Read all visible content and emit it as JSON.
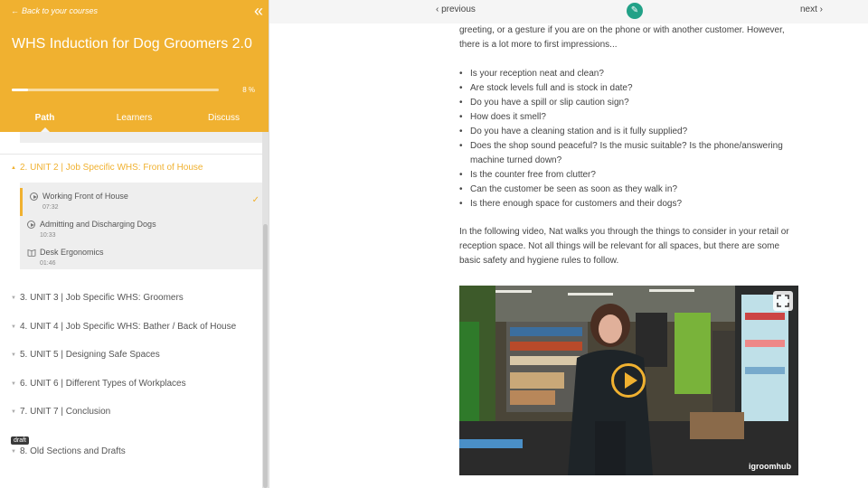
{
  "sidebar": {
    "back_link": "Back to your courses",
    "course_title": "WHS Induction for Dog Groomers 2.0",
    "progress_percent": 8,
    "progress_label": "8 %",
    "tabs": [
      "Path",
      "Learners",
      "Discuss"
    ],
    "units": [
      {
        "label": "2. UNIT 2 | Job Specific WHS: Front of House",
        "expanded": true
      },
      {
        "label": "3. UNIT 3 | Job Specific WHS: Groomers"
      },
      {
        "label": "4. UNIT 4 | Job Specific WHS: Bather / Back of House"
      },
      {
        "label": "5. UNIT 5 | Designing Safe Spaces"
      },
      {
        "label": "6. UNIT 6 | Different Types of Workplaces"
      },
      {
        "label": "7. UNIT 7 | Conclusion"
      },
      {
        "label": "8. Old Sections and Drafts",
        "badge": "draft"
      }
    ],
    "lessons": [
      {
        "title": "Working Front of House",
        "duration": "07:32",
        "icon": "play-circle-icon",
        "active": true,
        "completed": true
      },
      {
        "title": "Admitting and Discharging Dogs",
        "duration": "10:33",
        "icon": "play-circle-icon"
      },
      {
        "title": "Desk Ergonomics",
        "duration": "01:46",
        "icon": "book-icon"
      }
    ]
  },
  "topbar": {
    "previous_label": "‹ previous",
    "next_label": "next ›",
    "edit_icon": "pencil-icon"
  },
  "content": {
    "intro": "greeting, or a gesture if you are on the phone or with another customer. However, there is a lot more to first impressions...",
    "checklist": [
      "Is your reception neat and clean?",
      "Are stock levels full and is stock in date?",
      "Do you have a spill or slip caution sign?",
      "How does it smell?",
      "Do you have a cleaning station and is it fully supplied?",
      "Does the shop sound peaceful? Is the music suitable? Is the phone/answering machine turned down?",
      "Is the counter free from clutter?",
      "Can the customer be seen as soon as they walk in?",
      "Is there enough space for customers and their dogs?"
    ],
    "video_intro": "In the following video, Nat walks you through the things to consider in your retail or reception space. Not all things will be relevant for all spaces, but there are some basic safety and hygiene rules to follow.",
    "video": {
      "watermark": "igroomhub"
    }
  },
  "colors": {
    "accent": "#f0b130",
    "edit_button": "#22a187"
  }
}
